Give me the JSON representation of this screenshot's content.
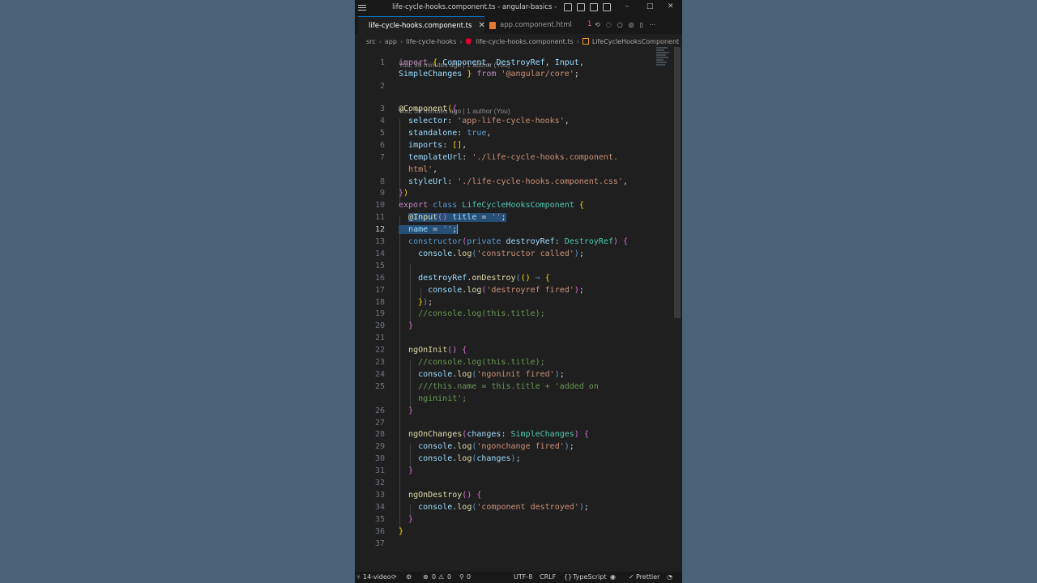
{
  "window": {
    "title": "life-cycle-hooks.component.ts - angular-basics - Visual ...",
    "controls": {
      "minimize": "–",
      "maximize": "□",
      "close": "✕"
    }
  },
  "tabs": [
    {
      "label": "life-cycle-hooks.component.ts",
      "icon": "angular-icon",
      "active": true,
      "close": "✕"
    },
    {
      "label": "app.component.html",
      "icon": "html-icon",
      "active": false
    }
  ],
  "tabbar": {
    "overflow_count": "1"
  },
  "breadcrumb": [
    "src",
    "app",
    "life-cycle-hooks",
    "life-cycle-hooks.component.ts",
    "LifeCycleHooksComponent"
  ],
  "codelens": {
    "first": "You, 39 minutes ago | 1 author (You)",
    "second": "You, 39 minutes ago | 1 author (You)"
  },
  "editor": {
    "current_line": "12",
    "lines": [
      {
        "n": "1",
        "text": "import { Component, DestroyRef, Input,"
      },
      {
        "n": "",
        "text": "SimpleChanges } from '@angular/core';"
      },
      {
        "n": "2",
        "text": ""
      },
      {
        "n": "3",
        "text": "@Component({"
      },
      {
        "n": "4",
        "text": "  selector: 'app-life-cycle-hooks',"
      },
      {
        "n": "5",
        "text": "  standalone: true,"
      },
      {
        "n": "6",
        "text": "  imports: [],"
      },
      {
        "n": "7",
        "text": "  templateUrl: './life-cycle-hooks.component."
      },
      {
        "n": "",
        "text": "  html',"
      },
      {
        "n": "8",
        "text": "  styleUrl: './life-cycle-hooks.component.css',"
      },
      {
        "n": "9",
        "text": "})"
      },
      {
        "n": "10",
        "text": "export class LifeCycleHooksComponent {"
      },
      {
        "n": "11",
        "text": "  @Input() title = '';"
      },
      {
        "n": "12",
        "text": "  name = '';"
      },
      {
        "n": "13",
        "text": "  constructor(private destroyRef: DestroyRef) {"
      },
      {
        "n": "14",
        "text": "    console.log('constructor called');"
      },
      {
        "n": "15",
        "text": ""
      },
      {
        "n": "16",
        "text": "    destroyRef.onDestroy(() => {"
      },
      {
        "n": "17",
        "text": "      console.log('destroyref fired');"
      },
      {
        "n": "18",
        "text": "    });"
      },
      {
        "n": "19",
        "text": "    //console.log(this.title);"
      },
      {
        "n": "20",
        "text": "  }"
      },
      {
        "n": "21",
        "text": ""
      },
      {
        "n": "22",
        "text": "  ngOnInit() {"
      },
      {
        "n": "23",
        "text": "    //console.log(this.title);"
      },
      {
        "n": "24",
        "text": "    console.log('ngoninit fired');"
      },
      {
        "n": "25",
        "text": "    ///this.name = this.title + 'added on"
      },
      {
        "n": "",
        "text": "    ngininit';"
      },
      {
        "n": "26",
        "text": "  }"
      },
      {
        "n": "27",
        "text": ""
      },
      {
        "n": "28",
        "text": "  ngOnChanges(changes: SimpleChanges) {"
      },
      {
        "n": "29",
        "text": "    console.log('ngonchange fired');"
      },
      {
        "n": "30",
        "text": "    console.log(changes);"
      },
      {
        "n": "31",
        "text": "  }"
      },
      {
        "n": "32",
        "text": ""
      },
      {
        "n": "33",
        "text": "  ngOnDestroy() {"
      },
      {
        "n": "34",
        "text": "    console.log('component destroyed');"
      },
      {
        "n": "35",
        "text": "  }"
      },
      {
        "n": "36",
        "text": "}"
      },
      {
        "n": "37",
        "text": ""
      }
    ]
  },
  "statusbar": {
    "branch": "14-video",
    "problems_errors": "0",
    "problems_warnings": "0",
    "ports": "0",
    "encoding": "UTF-8",
    "eol": "CRLF",
    "language": "TypeScript",
    "formatter": "Prettier"
  }
}
